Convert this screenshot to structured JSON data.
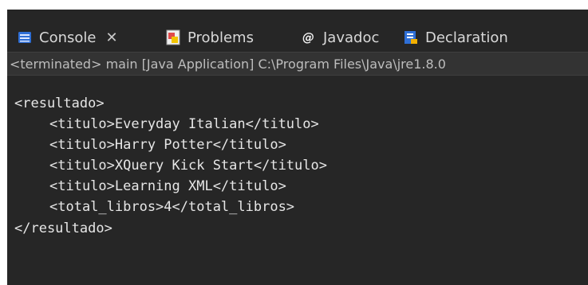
{
  "tabs": {
    "console": {
      "label": "Console",
      "icon": "console-icon",
      "active": true,
      "close": "✕"
    },
    "problems": {
      "label": "Problems",
      "icon": "problems-icon"
    },
    "javadoc": {
      "label": "Javadoc",
      "icon": "javadoc-icon"
    },
    "declaration": {
      "label": "Declaration",
      "icon": "declaration-icon"
    }
  },
  "status": {
    "text": "<terminated> main [Java Application] C:\\Program Files\\Java\\jre1.8.0"
  },
  "output": {
    "lines": [
      "<resultado>",
      "<titulo>Everyday Italian</titulo>",
      "<titulo>Harry Potter</titulo>",
      "<titulo>XQuery Kick Start</titulo>",
      "<titulo>Learning XML</titulo>",
      "<total_libros>4</total_libros>",
      "</resultado>"
    ]
  },
  "colors": {
    "panel_bg": "#262626",
    "text": "#d8d8d8",
    "accent_blue": "#2f6fd6",
    "problems_red": "#e14b4b"
  }
}
